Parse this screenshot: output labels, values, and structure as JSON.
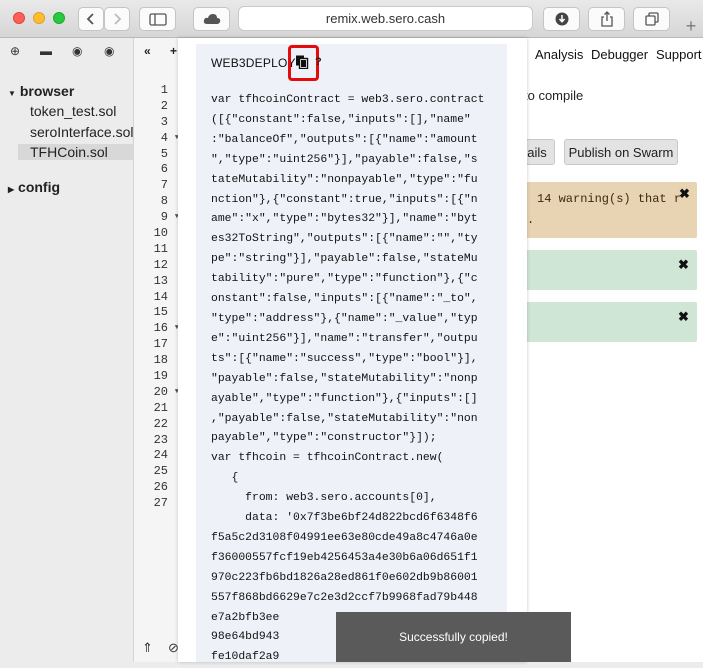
{
  "browser": {
    "url": "remix.web.sero.cash",
    "plus": "+"
  },
  "file_panel": {
    "folders": [
      {
        "label": "browser"
      },
      {
        "label": "config"
      }
    ],
    "files": [
      "token_test.sol",
      "seroInterface.sol",
      "TFHCoin.sol"
    ],
    "selected_file": "TFHCoin.sol"
  },
  "editor": {
    "line_numbers": [
      "1",
      "2",
      "3",
      "4",
      "5",
      "6",
      "7",
      "8",
      "9",
      "10",
      "11",
      "12",
      "13",
      "14",
      "15",
      "16",
      "17",
      "18",
      "19",
      "20",
      "21",
      "22",
      "23",
      "24",
      "25",
      "26",
      "27"
    ],
    "folded_lines": [
      "4",
      "9",
      "16",
      "20"
    ]
  },
  "right_panel": {
    "tabs": [
      "Analysis",
      "Debugger",
      "Support"
    ],
    "compile_text": "to compile",
    "details_button": "ails",
    "publish_button": "Publish on Swarm",
    "warning_line1": "14 warning(s) that r",
    "warning_line2": "."
  },
  "modal": {
    "title": "WEB3DEPLOY",
    "code_lines": [
      "var tfhcoinContract = web3.sero.contract",
      "([{\"constant\":false,\"inputs\":[],\"name\"",
      ":\"balanceOf\",\"outputs\":[{\"name\":\"amount",
      "\",\"type\":\"uint256\"}],\"payable\":false,\"s",
      "tateMutability\":\"nonpayable\",\"type\":\"fu",
      "nction\"},{\"constant\":true,\"inputs\":[{\"n",
      "ame\":\"x\",\"type\":\"bytes32\"}],\"name\":\"byt",
      "es32ToString\",\"outputs\":[{\"name\":\"\",\"ty",
      "pe\":\"string\"}],\"payable\":false,\"stateMu",
      "tability\":\"pure\",\"type\":\"function\"},{\"c",
      "onstant\":false,\"inputs\":[{\"name\":\"_to\",",
      "\"type\":\"address\"},{\"name\":\"_value\",\"typ",
      "e\":\"uint256\"}],\"name\":\"transfer\",\"outpu",
      "ts\":[{\"name\":\"success\",\"type\":\"bool\"}],",
      "\"payable\":false,\"stateMutability\":\"nonp",
      "ayable\",\"type\":\"function\"},{\"inputs\":[]",
      ",\"payable\":false,\"stateMutability\":\"non",
      "payable\",\"type\":\"constructor\"}]);",
      "var tfhcoin = tfhcoinContract.new(",
      "   {",
      "     from: web3.sero.accounts[0],",
      "     data: '0x7f3be6bf24d822bcd6f6348f6",
      "f5a5c2d3108f04991ee63e80cde49a8c4746a0e",
      "f36000557fcf19eb4256453a4e30b6a06d651f1",
      "970c223fb6bd1826a28ed861f0e602db9b86001",
      "557f868bd6629e7c2e3d2ccf7b9968fad79b448",
      "e7a2bfb3ee",
      "98e64bd943",
      "fe10daf2a9"
    ]
  },
  "toast": {
    "message": "Successfully copied!"
  }
}
